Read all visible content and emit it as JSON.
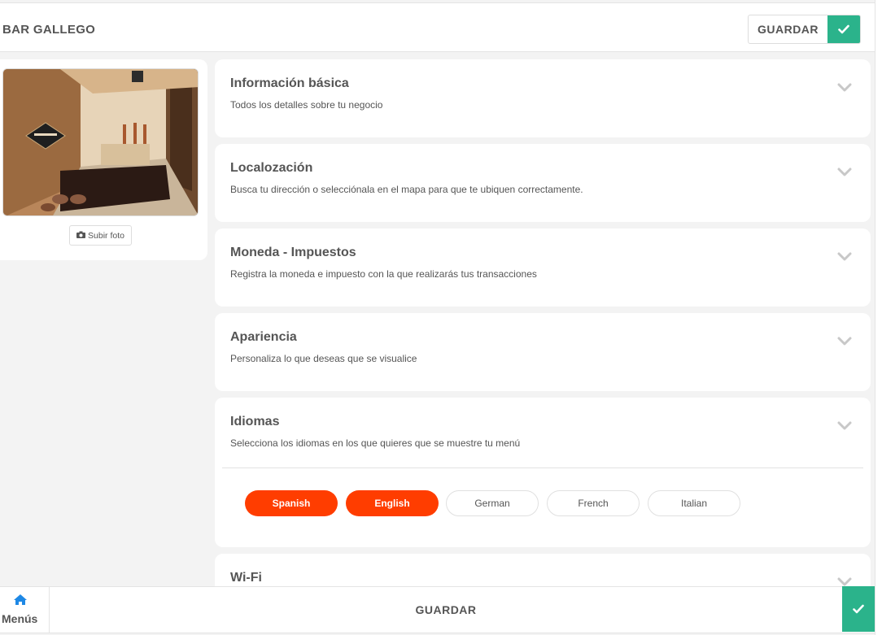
{
  "header": {
    "title": "BAR GALLEGO",
    "save_label": "GUARDAR"
  },
  "photo_card": {
    "upload_label": "Subir foto"
  },
  "sections": [
    {
      "title": "Información básica",
      "description": "Todos los detalles sobre tu negocio"
    },
    {
      "title": "Localozación",
      "description": "Busca tu dirección o selecciónala en el mapa para que te ubiquen correctamente."
    },
    {
      "title": "Moneda - Impuestos",
      "description": "Registra la moneda e impuesto con la que realizarás tus transacciones"
    },
    {
      "title": "Apariencia",
      "description": "Personaliza lo que deseas que se visualice"
    },
    {
      "title": "Idiomas",
      "description": "Selecciona los idiomas en los que quieres que se muestre tu menú"
    },
    {
      "title": "Wi-Fi",
      "description": ""
    }
  ],
  "languages": [
    {
      "label": "Spanish",
      "selected": true
    },
    {
      "label": "English",
      "selected": true
    },
    {
      "label": "German",
      "selected": false
    },
    {
      "label": "French",
      "selected": false
    },
    {
      "label": "Italian",
      "selected": false
    }
  ],
  "bottom_bar": {
    "menus_label": "Menús",
    "save_label": "GUARDAR"
  },
  "colors": {
    "accent_green": "#2bb38b",
    "language_active": "#ff3d00",
    "home_icon": "#1e88e5"
  },
  "icons": {
    "save_check": "check-icon",
    "section_toggle": "chevron-down-icon",
    "upload": "camera-icon",
    "menus": "home-icon"
  }
}
